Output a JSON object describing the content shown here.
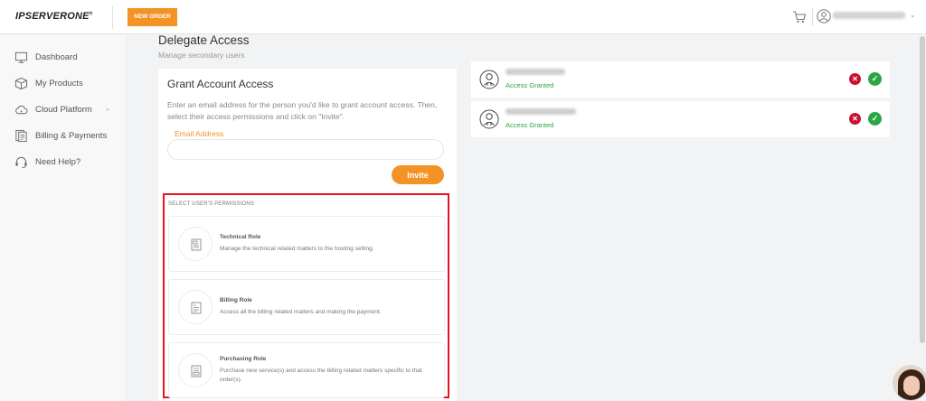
{
  "header": {
    "logo_text": "IPSERVERONE",
    "logo_registered": "®",
    "new_order_label": "NEW ORDER"
  },
  "sidebar": {
    "items": [
      {
        "label": "Dashboard",
        "icon": "monitor-icon"
      },
      {
        "label": "My Products",
        "icon": "box-icon"
      },
      {
        "label": "Cloud Platform",
        "icon": "cloud-icon",
        "has_chevron": true
      },
      {
        "label": "Billing & Payments",
        "icon": "billing-icon"
      },
      {
        "label": "Need Help?",
        "icon": "headset-icon"
      }
    ]
  },
  "page": {
    "title": "Delegate Access",
    "subtitle": "Manage secondary users"
  },
  "grant": {
    "title": "Grant Account Access",
    "description": "Enter an email address for the person you'd like to grant account access. Then, select their access permissions and click on \"Invite\".",
    "email_label": "Email Address",
    "email_value": "",
    "invite_label": "Invite"
  },
  "permissions": {
    "heading": "SELECT USER'S PERMISSIONS",
    "roles": [
      {
        "name": "Technical Role",
        "description": "Manage the technical related matters to the hosting setting."
      },
      {
        "name": "Billing Role",
        "description": "Access all the billing related matters and making the payment."
      },
      {
        "name": "Purchasing Role",
        "description": "Purchase new service(s) and access the billing related matters specific to that order(s)."
      }
    ]
  },
  "users": [
    {
      "status": "Access Granted"
    },
    {
      "status": "Access Granted"
    }
  ],
  "colors": {
    "accent": "#f39325",
    "granted": "#2aa745",
    "revoke": "#c8102e",
    "highlight_border": "#e8141b"
  }
}
